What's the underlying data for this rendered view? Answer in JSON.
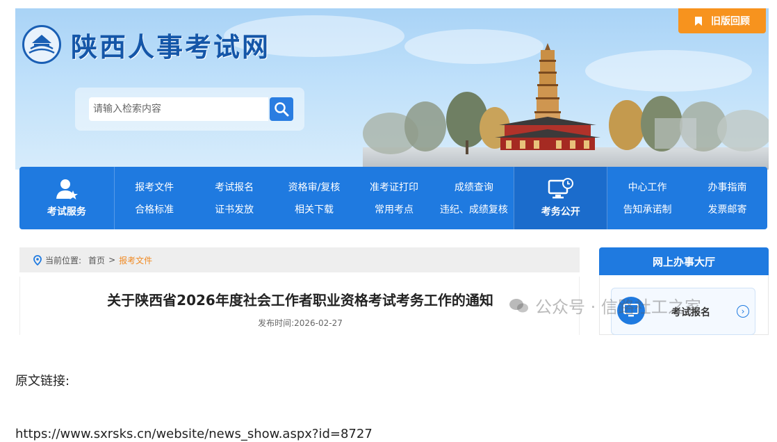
{
  "header": {
    "site_title": "陕西人事考试网",
    "old_version_label": "旧版回顾",
    "old_version_icon": "bookmark-icon",
    "logo_icon": "pagoda-emblem-icon"
  },
  "search": {
    "placeholder": "请输入检索内容",
    "button_icon": "search-icon"
  },
  "nav": {
    "exam_service": {
      "label": "考试服务",
      "icon": "user-star-icon"
    },
    "columns": [
      {
        "top": "报考文件",
        "bottom": "合格标准"
      },
      {
        "top": "考试报名",
        "bottom": "证书发放"
      },
      {
        "top": "资格审/复核",
        "bottom": "相关下载"
      },
      {
        "top": "准考证打印",
        "bottom": "常用考点"
      },
      {
        "top": "成绩查询",
        "bottom": "违纪、成绩复核"
      }
    ],
    "exam_public": {
      "label": "考务公开",
      "icon": "monitor-clock-icon"
    },
    "columns_right": [
      {
        "top": "中心工作",
        "bottom": "告知承诺制"
      },
      {
        "top": "办事指南",
        "bottom": "发票邮寄"
      }
    ]
  },
  "breadcrumb": {
    "location_label": "当前位置:",
    "home": "首页",
    "separator": ">",
    "current": "报考文件",
    "icon": "location-pin-icon"
  },
  "article": {
    "title": "关于陕西省2026年度社会工作者职业资格考试考务工作的通知",
    "publish_time": "发布时间:2026-02-27"
  },
  "sidebar": {
    "heading": "网上办事大厅",
    "item_label": "考试报名",
    "item_icon": "monitor-icon",
    "arrow_icon": "chevron-right-circle-icon"
  },
  "watermark": {
    "text": "公众号 · 信路社工之家",
    "icon": "wechat-icon"
  },
  "footer": {
    "link_label": "原文链接:",
    "link_url": "https://www.sxrsks.cn/website/news_show.aspx?id=8727"
  },
  "colors": {
    "primary_blue": "#1f7ae0",
    "orange": "#f7931e",
    "breadcrumb_current": "#f08a24"
  }
}
